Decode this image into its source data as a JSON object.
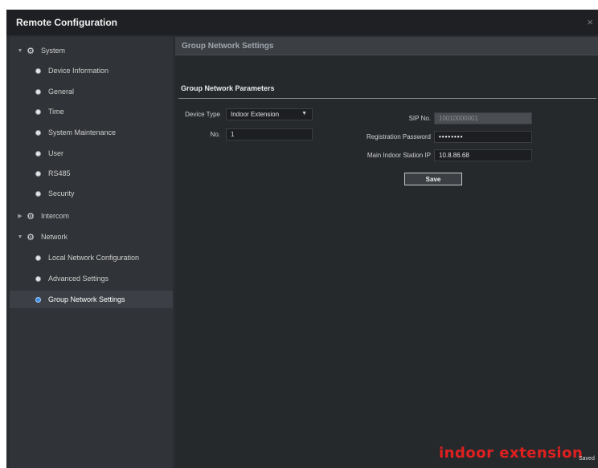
{
  "window": {
    "title": "Remote Configuration",
    "close_glyph": "×"
  },
  "sidebar": {
    "nodes": [
      {
        "label": "System",
        "type": "parent",
        "expanded": true,
        "icon": "gear-icon"
      },
      {
        "label": "Device Information",
        "type": "child"
      },
      {
        "label": "General",
        "type": "child"
      },
      {
        "label": "Time",
        "type": "child"
      },
      {
        "label": "System Maintenance",
        "type": "child"
      },
      {
        "label": "User",
        "type": "child"
      },
      {
        "label": "RS485",
        "type": "child"
      },
      {
        "label": "Security",
        "type": "child"
      },
      {
        "label": "Intercom",
        "type": "parent",
        "expanded": false,
        "icon": "gear-icon"
      },
      {
        "label": "Network",
        "type": "parent",
        "expanded": true,
        "icon": "gear-icon"
      },
      {
        "label": "Local Network Configuration",
        "type": "child"
      },
      {
        "label": "Advanced Settings",
        "type": "child"
      },
      {
        "label": "Group Network Settings",
        "type": "child",
        "selected": true
      }
    ]
  },
  "main": {
    "section_title": "Group Network Settings",
    "subheading": "Group Network Parameters",
    "fields": {
      "device_type": {
        "label": "Device Type",
        "value": "Indoor Extension"
      },
      "no": {
        "label": "No.",
        "value": "1"
      },
      "sip_no": {
        "label": "SIP No.",
        "value": "10010000001"
      },
      "registration_password": {
        "label": "Registration Password",
        "value": "••••••••"
      },
      "main_indoor_station_ip": {
        "label": "Main Indoor Station IP",
        "value": "10.8.86.68"
      }
    },
    "save_label": "Save"
  },
  "overlay": {
    "watermark_text": "indoor extension",
    "status_text": "Saved"
  },
  "colors": {
    "background": "#2a2d31",
    "sidebar": "#303337",
    "content": "#26292c",
    "selected_dot": "#3a8ee6",
    "watermark": "#e02020"
  }
}
